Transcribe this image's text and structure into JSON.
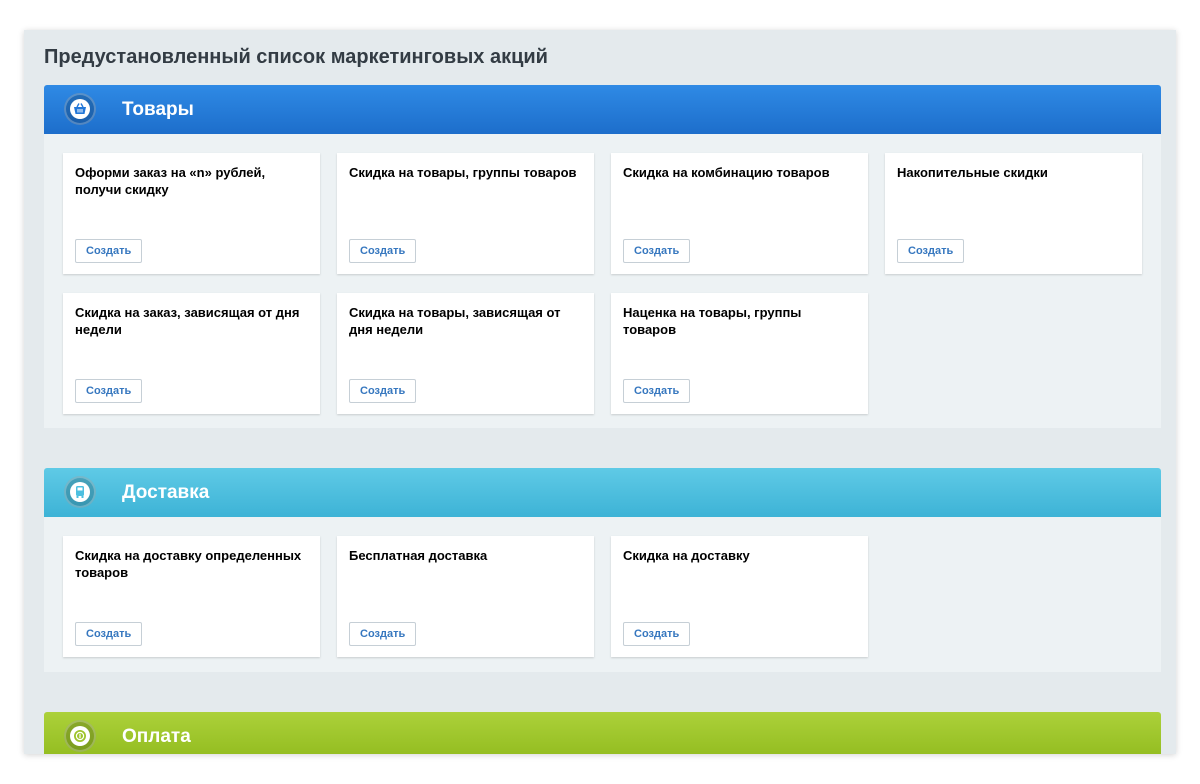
{
  "page": {
    "title": "Предустановленный список маркетинговых акций"
  },
  "sections": {
    "goods": {
      "title": "Товары",
      "icon": "basket-icon",
      "color": "#2277d8",
      "cards": [
        {
          "title": "Оформи заказ на «n» рублей, получи скидку",
          "button": "Создать"
        },
        {
          "title": "Скидка на товары, группы товаров",
          "button": "Создать"
        },
        {
          "title": "Скидка на комбинацию товаров",
          "button": "Создать"
        },
        {
          "title": "Накопительные скидки",
          "button": "Создать"
        },
        {
          "title": "Скидка на заказ, зависящая от дня недели",
          "button": "Создать"
        },
        {
          "title": "Скидка на товары, зависящая от дня недели",
          "button": "Создать"
        },
        {
          "title": "Наценка на товары, группы товаров",
          "button": "Создать"
        }
      ]
    },
    "delivery": {
      "title": "Доставка",
      "icon": "truck-icon",
      "color": "#4cbfe0",
      "cards": [
        {
          "title": "Скидка на доставку определенных товаров",
          "button": "Создать"
        },
        {
          "title": "Бесплатная доставка",
          "button": "Создать"
        },
        {
          "title": "Скидка на доставку",
          "button": "Создать"
        }
      ]
    },
    "payment": {
      "title": "Оплата",
      "icon": "coin-icon",
      "color": "#9fc42c"
    }
  }
}
